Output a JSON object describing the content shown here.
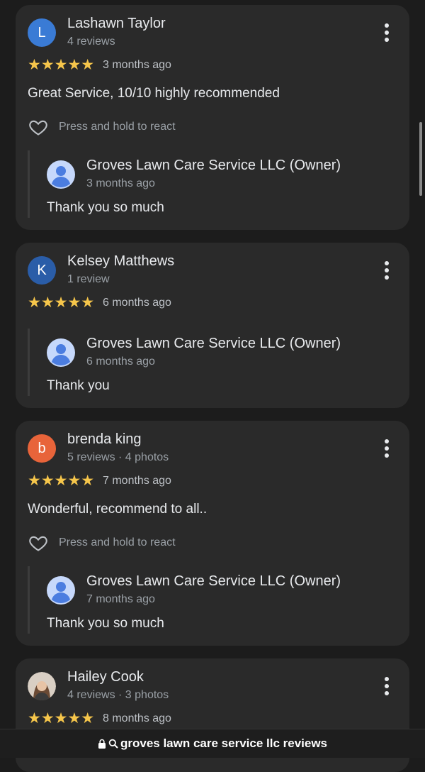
{
  "reviews": [
    {
      "initial": "L",
      "avatar_color": "#3a7bd5",
      "name": "Lashawn Taylor",
      "meta": "4 reviews",
      "stars": "★★★★★",
      "ago": "3 months ago",
      "text": "Great Service, 10/10 highly recommended",
      "react": "Press and hold to react",
      "owner": {
        "name": "Groves Lawn Care Service LLC (Owner)",
        "ago": "3 months ago",
        "text": "Thank you so much"
      }
    },
    {
      "initial": "K",
      "avatar_color": "#2a5da8",
      "name": "Kelsey Matthews",
      "meta": "1 review",
      "stars": "★★★★★",
      "ago": "6 months ago",
      "owner": {
        "name": "Groves Lawn Care Service LLC (Owner)",
        "ago": "6 months ago",
        "text": "Thank you"
      }
    },
    {
      "initial": "b",
      "avatar_color": "#e8643a",
      "name": "brenda king",
      "meta": "5 reviews · 4 photos",
      "stars": "★★★★★",
      "ago": "7 months ago",
      "text": "Wonderful, recommend to all..",
      "react": "Press and hold to react",
      "owner": {
        "name": "Groves Lawn Care Service LLC (Owner)",
        "ago": "7 months ago",
        "text": "Thank you so much"
      }
    },
    {
      "name": "Hailey Cook",
      "meta": "4 reviews · 3 photos",
      "stars": "★★★★★",
      "ago": "8 months ago"
    }
  ],
  "browser": {
    "url_text": "groves lawn care service llc reviews"
  },
  "colors": {
    "star": "#f6c64b",
    "card": "#2a2a2a",
    "background": "#1c1c1c"
  }
}
